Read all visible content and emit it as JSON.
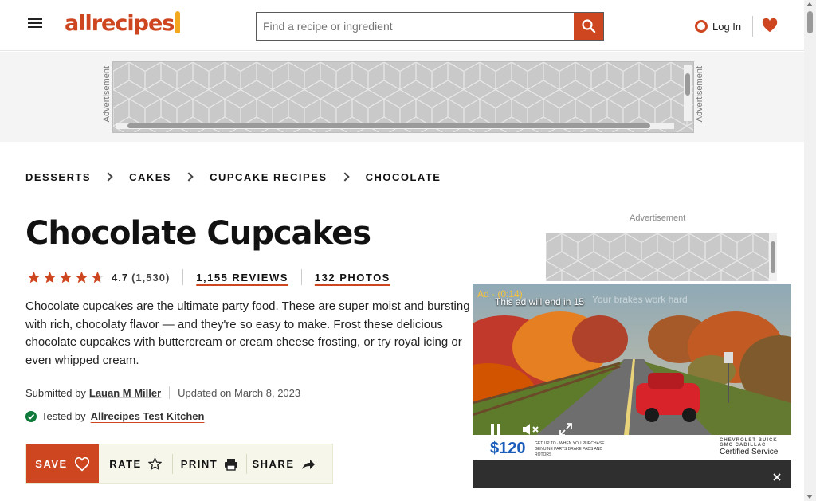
{
  "header": {
    "menu_icon": "hamburger-menu-icon",
    "logo_text": "allrecipes",
    "search_placeholder": "Find a recipe or ingredient",
    "search_icon": "search-icon",
    "login_label": "Log In",
    "saved_icon": "heart-icon",
    "accent_color": "#ce4620"
  },
  "top_ad": {
    "label_left": "Advertisement",
    "label_right": "Advertisement"
  },
  "breadcrumbs": [
    "Desserts",
    "Cakes",
    "Cupcake Recipes",
    "Chocolate"
  ],
  "recipe": {
    "title": "Chocolate Cupcakes",
    "rating_value": "4.7",
    "rating_count": "(1,530)",
    "stars": 5,
    "reviews_label": "1,155 REVIEWS",
    "photos_label": "132 PHOTOS",
    "description": "Chocolate cupcakes are the ultimate party food. These are super moist and bursting with rich, chocolaty flavor — and they're so easy to make. Frost these delicious chocolate cupcakes with buttercream or cream cheese frosting, or try royal icing or even whipped cream.",
    "submitted_by_label": "Submitted by",
    "author": "Lauan M Miller",
    "updated": "Updated on March 8, 2023",
    "tested_by_label": "Tested by",
    "tested_by": "Allrecipes Test Kitchen"
  },
  "actions": {
    "save": "Save",
    "rate": "Rate",
    "print": "Print",
    "share": "Share"
  },
  "side_ad": {
    "label": "Advertisement"
  },
  "video_ad": {
    "ad_label": "Ad · (0:14)",
    "countdown": "This ad will end in 15",
    "headline": "Your brakes work hard",
    "price": "$120",
    "offer_text": "GET UP TO · WHEN YOU PURCHASE GENUINE PARTS BRAKE PADS AND ROTORS",
    "brands": "CHEVROLET BUICK GMC CADILLAC",
    "certified": "Certified Service"
  }
}
